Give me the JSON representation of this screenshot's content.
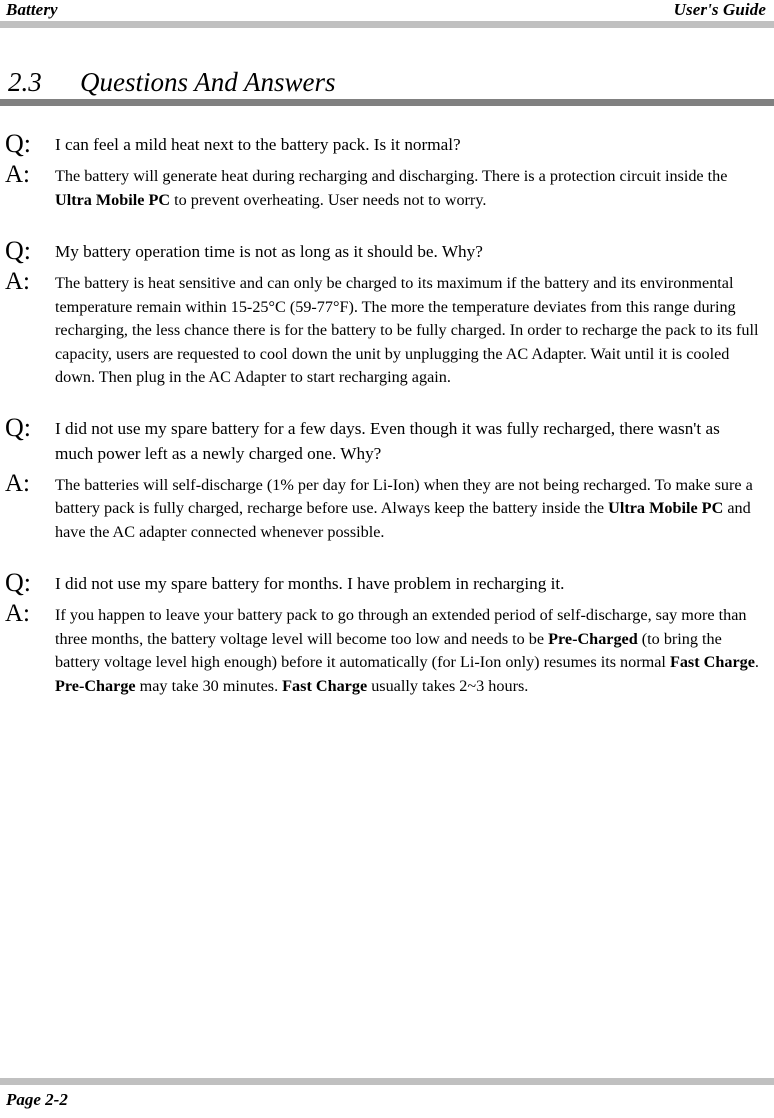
{
  "header": {
    "left": "Battery",
    "right": "User's Guide"
  },
  "heading": {
    "number": "2.3",
    "title": "Questions And Answers"
  },
  "labels": {
    "question": "Q:",
    "answer": "A:"
  },
  "qa": [
    {
      "question": "I can feel a mild heat next to the battery pack. Is it normal?",
      "answer_html": "The battery will generate heat during recharging and discharging. There is a protection circuit inside the <b>Ultra Mobile PC</b> to prevent overheating. User needs not to worry."
    },
    {
      "question": "My battery operation time is not as long as it should be. Why?",
      "answer_html": "The battery is heat sensitive and can only be charged to its maximum if the battery and its environmental temperature remain within 15-25&deg;C (59-77&deg;F). The more the temperature deviates from this range during recharging, the less chance there is for the battery to be fully charged. In order to recharge the pack to its full capacity, users are requested to cool down the unit by unplugging the AC Adapter. Wait until it is cooled down. Then plug in the AC Adapter to start recharging again."
    },
    {
      "question": "I did not use my spare battery for a few days. Even though it was fully recharged, there wasn't as much power left as a newly charged one. Why?",
      "answer_html": "The batteries will self-discharge (1% per day for Li-Ion) when they are not being recharged. To make sure a battery pack is fully charged, recharge before use. Always keep the battery inside the <b>Ultra Mobile PC</b> and have the AC adapter connected whenever possible."
    },
    {
      "question": "I did not use my spare battery for months. I have problem in recharging it.",
      "answer_html": "If you happen to leave your battery pack to go through an extended period of self-discharge, say more than three months, the battery voltage level will become too low and needs to be <b>Pre-Charged</b> (to bring the battery voltage level high enough) before it automatically (for Li-Ion only) resumes its normal <b>Fast Charge</b>. <b>Pre-Charge</b> may take 30 minutes. <b>Fast Charge</b> usually takes 2~3 hours."
    }
  ],
  "footer": {
    "page_label": "Page 2-2"
  },
  "colors": {
    "rule_light": "#c0c0c0",
    "rule_dark": "#808080",
    "text": "#000000",
    "background": "#ffffff"
  }
}
